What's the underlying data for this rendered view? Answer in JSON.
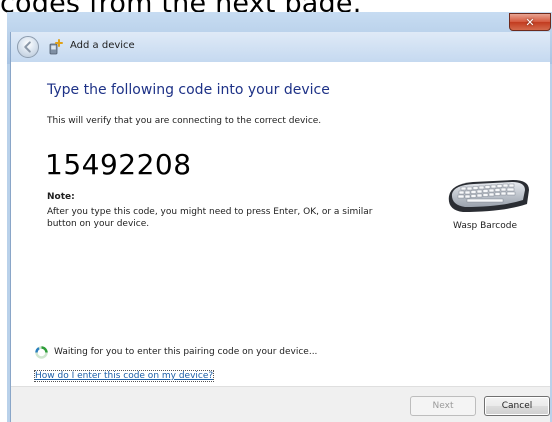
{
  "caption": "codes from the next page.",
  "window": {
    "nav_title": "Add a device"
  },
  "content": {
    "heading": "Type the following code into your device",
    "subtext": "This will verify that you are connecting to the correct device.",
    "code": "15492208",
    "note_label": "Note:",
    "note_text": "After you type this code, you might need to press Enter, OK, or a similar button on your device.",
    "status_text": "Waiting for you to enter this pairing code on your device...",
    "help_link": "How do I enter this code on my device?"
  },
  "device": {
    "name": "Wasp Barcode",
    "icon": "keyboard-icon"
  },
  "buttons": {
    "next_label": "Next",
    "cancel_label": "Cancel"
  },
  "colors": {
    "heading": "#1e3287",
    "link": "#1d5fa8",
    "close": "#c23b1f",
    "frame": "#b9d1ea"
  }
}
